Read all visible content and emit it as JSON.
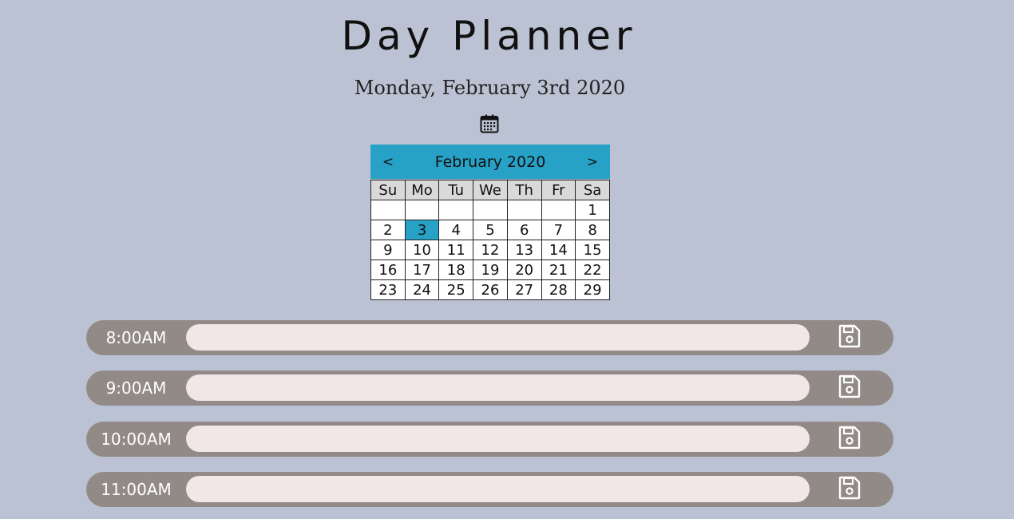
{
  "header": {
    "title": "Day Planner",
    "date": "Monday, February 3rd 2020"
  },
  "calendar": {
    "icon": "calendar-icon",
    "month_label": "February 2020",
    "prev_label": "<",
    "next_label": ">",
    "accent_color": "#28a1c6",
    "weekdays": [
      "Su",
      "Mo",
      "Tu",
      "We",
      "Th",
      "Fr",
      "Sa"
    ],
    "weeks": [
      [
        "",
        "",
        "",
        "",
        "",
        "",
        "1"
      ],
      [
        "2",
        "3",
        "4",
        "5",
        "6",
        "7",
        "8"
      ],
      [
        "9",
        "10",
        "11",
        "12",
        "13",
        "14",
        "15"
      ],
      [
        "16",
        "17",
        "18",
        "19",
        "20",
        "21",
        "22"
      ],
      [
        "23",
        "24",
        "25",
        "26",
        "27",
        "28",
        "29"
      ]
    ],
    "selected_day": "3"
  },
  "hours": [
    {
      "label": "8:00AM",
      "value": "",
      "save_icon": "save-icon"
    },
    {
      "label": "9:00AM",
      "value": "",
      "save_icon": "save-icon"
    },
    {
      "label": "10:00AM",
      "value": "",
      "save_icon": "save-icon"
    },
    {
      "label": "11:00AM",
      "value": "",
      "save_icon": "save-icon"
    }
  ],
  "colors": {
    "background": "#bbc2d3",
    "row": "#918a87",
    "input": "#f1e7e6"
  }
}
